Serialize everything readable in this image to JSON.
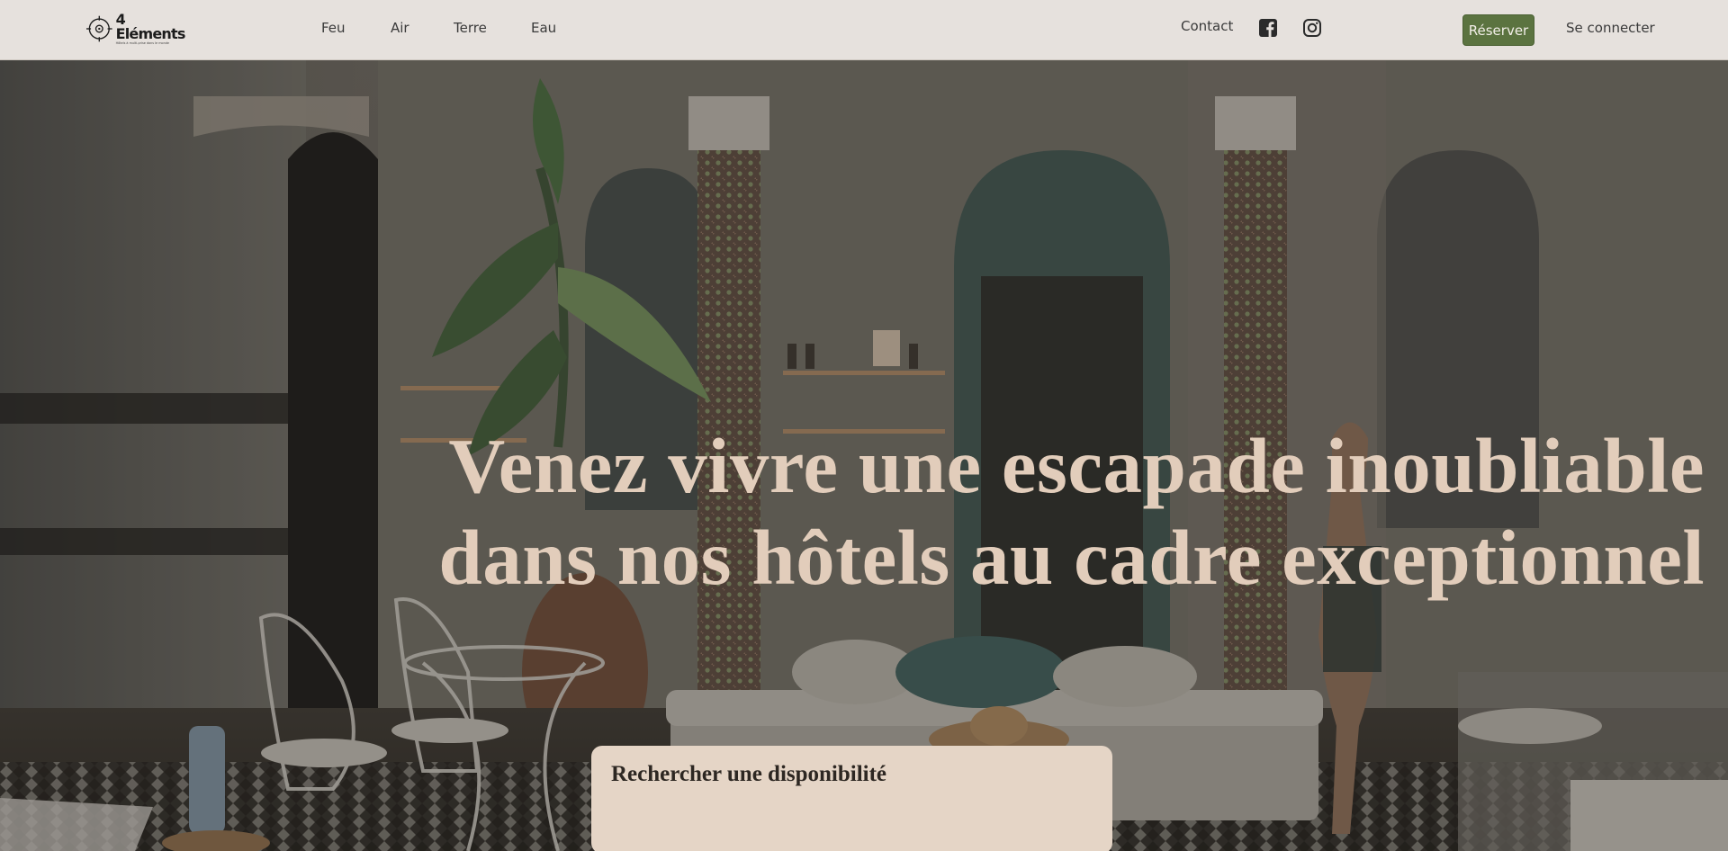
{
  "brand": {
    "name": "4 Eléments",
    "tagline": "Hôtels à multi-prise dans le monde"
  },
  "nav": {
    "items": [
      "Feu",
      "Air",
      "Terre",
      "Eau"
    ],
    "contact": "Contact",
    "reserve": "Réserver",
    "login": "Se connecter"
  },
  "social": [
    "facebook-icon",
    "instagram-icon"
  ],
  "hero": {
    "title_line1": "Venez vivre une escapade inoubliable",
    "title_line2": "dans nos hôtels au cadre exceptionnel"
  },
  "search": {
    "title": "Rechercher une disponibilité"
  },
  "colors": {
    "header_bg": "#e6e1dd",
    "accent_green": "#5b7340",
    "hero_text": "#e2cdbb",
    "card_bg": "#e5d5c6"
  }
}
